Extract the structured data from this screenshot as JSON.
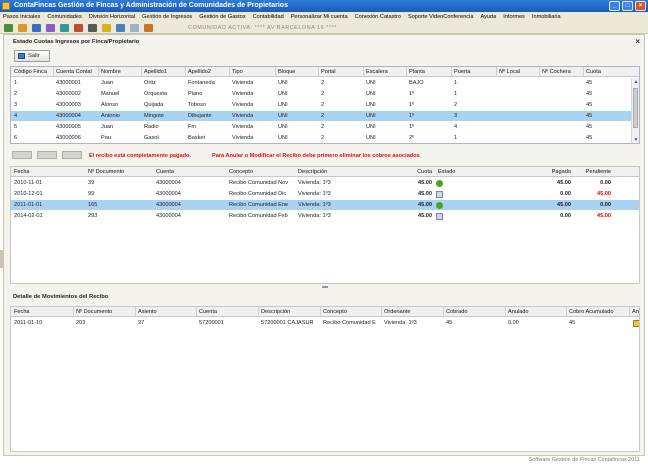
{
  "window": {
    "title": "ContaFincas Gestión de Fincas y Administración de Comunidades de Propietarios"
  },
  "menu": [
    "Pasos Iniciales",
    "Comunidades",
    "División Horizontal",
    "Gestión de Ingresos",
    "Gestión de Gastos",
    "Contabilidad",
    "Personalizar Mi cuenta",
    "Conexión Catastro",
    "Soporte VideoConferencia",
    "Ayuda",
    "Informes",
    "Inmobiliaria"
  ],
  "toolbar": {
    "active_label": "COMUNIDAD ACTIVA: **** AV BARCELONA 16 ****"
  },
  "panel": {
    "title": "Estado Cuotas Ingresos por Finca/Propietario",
    "salir": "Salir"
  },
  "fincas": {
    "columns": [
      "Código Finca",
      "Cuenta Contal",
      "Nombre",
      "Apellido1",
      "Apellido2",
      "Tipo",
      "Bloque",
      "Portal",
      "Escalera",
      "Planta",
      "Puerta",
      "Nº Local",
      "Nº Cochera",
      "Cuota"
    ],
    "rows": [
      [
        "1",
        "43000001",
        "Juan",
        "Ortiz",
        "Fontaneda",
        "Vivienda",
        "UNI",
        "2",
        "UNI",
        "BAJO",
        "1",
        "",
        "",
        "45"
      ],
      [
        "2",
        "43000002",
        "Manuel",
        "Orquesta",
        "Piano",
        "Vivienda",
        "UNI",
        "2",
        "UNI",
        "1º",
        "1",
        "",
        "",
        "45"
      ],
      [
        "3",
        "43000003",
        "Alonso",
        "Quijada",
        "Toboso",
        "Vivienda",
        "UNI",
        "2",
        "UNI",
        "1º",
        "2",
        "",
        "",
        "45"
      ],
      [
        "4",
        "43000004",
        "Antonio",
        "Mingote",
        "Dibujante",
        "Vivienda",
        "UNI",
        "2",
        "UNI",
        "1º",
        "3",
        "",
        "",
        "45"
      ],
      [
        "5",
        "43000005",
        "Juan",
        "Radio",
        "Fm",
        "Vivienda",
        "UNI",
        "2",
        "UNI",
        "1º",
        "4",
        "",
        "",
        "45"
      ],
      [
        "6",
        "43000006",
        "Pau",
        "Gasol",
        "Basket",
        "Vivienda",
        "UNI",
        "2",
        "UNI",
        "2º",
        "1",
        "",
        "",
        "45"
      ]
    ],
    "selected": 3
  },
  "messages": {
    "pagado": "El recibo está completamente pagado.",
    "anular": "Para Anular o Modificar el Recibo debe primero eliminar los cobros asociados"
  },
  "recibos": {
    "columns": [
      "Fecha",
      "Nº Documento",
      "Cuenta",
      "Concepto",
      "Descripción",
      "Cuota",
      "Estado",
      "Pagado",
      "Pendiente"
    ],
    "rows": [
      {
        "fecha": "2010-11-01",
        "doc": "39",
        "cuenta": "43000004",
        "concepto": "Recibo Comunidad Nov",
        "desc": "Vivienda: 1º3",
        "cuota": "45.00",
        "estado": "ok",
        "pagado": "45.00",
        "pendiente": "0.00",
        "pend_color": "black"
      },
      {
        "fecha": "2010-12-01",
        "doc": "99",
        "cuenta": "43000004",
        "concepto": "Recibo Comunidad Dic",
        "desc": "Vivienda: 1º3",
        "cuota": "45.00",
        "estado": "doc",
        "pagado": "0.00",
        "pendiente": "45.00",
        "pend_color": "red"
      },
      {
        "fecha": "2011-01-01",
        "doc": "165",
        "cuenta": "43000004",
        "concepto": "Recibo Comunidad Ene",
        "desc": "Vivienda: 1º3",
        "cuota": "45.00",
        "estado": "ok",
        "pagado": "45.00",
        "pendiente": "0.00",
        "pend_color": "black"
      },
      {
        "fecha": "2014-02-01",
        "doc": "293",
        "cuenta": "43000004",
        "concepto": "Recibo Comunidad Feb",
        "desc": "Vivienda: 1º3",
        "cuota": "45.00",
        "estado": "doc",
        "pagado": "0.00",
        "pendiente": "45.00",
        "pend_color": "red"
      }
    ],
    "selected": 2
  },
  "detalle": {
    "title": "Detalle de Movimientos del Recibo",
    "columns": [
      "Fecha",
      "Nº Documento",
      "Asiento",
      "Cuenta",
      "Descripción",
      "Concepto",
      "Ordenante",
      "Cobrado",
      "Anulado",
      "Cobro Acumulado",
      "An"
    ],
    "rows": [
      [
        "2011-01-10",
        "203",
        "97",
        "57200001",
        "57200001 CAJASUR",
        "Recibo Comunidad E",
        "Vivienda: 1º3",
        "45",
        "0.00",
        "45"
      ]
    ]
  },
  "footer": "Software Gestión de Fincas Contafincas 2011"
}
